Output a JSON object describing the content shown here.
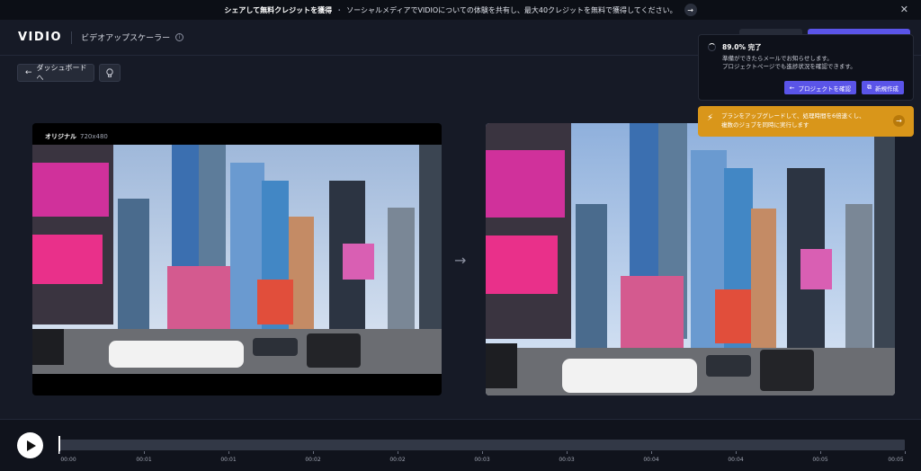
{
  "banner": {
    "bold_text": "シェアして無料クレジットを獲得",
    "separator": "・",
    "text": "ソーシャルメディアでVIDIOについての体験を共有し、最大40クレジットを無料で獲得してください。",
    "go_icon": "arrow-right-icon",
    "close_icon": "close-icon"
  },
  "header": {
    "logo": "VIDIO",
    "tool_title": "ビデオアップスケーラー",
    "info_icon": "info-icon"
  },
  "toolbar": {
    "back_label": "ダッシュボードへ",
    "back_icon": "arrow-left-icon",
    "tips_icon": "lightbulb-icon"
  },
  "preview": {
    "original_label": "オリジナル",
    "original_resolution": "720x480",
    "compare_icon": "arrow-right-icon"
  },
  "progress_toast": {
    "title": "89.0% 完了",
    "progress_percent": 89.0,
    "line1": "準備ができたらメールでお知らせします。",
    "line2": "プロジェクトページでも進捗状況を確認できます。",
    "check_project_label": "プロジェクトを確認",
    "new_label": "新規作成"
  },
  "upgrade_toast": {
    "line1": "プランをアップグレードして、処理時間を6倍速くし、",
    "line2": "複数のジョブを同時に実行します",
    "color": "#d9961a"
  },
  "timeline": {
    "ticks": [
      "00:00",
      "00:01",
      "00:01",
      "00:02",
      "00:02",
      "00:03",
      "00:03",
      "00:04",
      "00:04",
      "00:05",
      "00:05"
    ],
    "playhead_fraction": 0.0
  },
  "colors": {
    "accent": "#5a54e8",
    "background": "#161a26",
    "warning": "#d9961a"
  }
}
